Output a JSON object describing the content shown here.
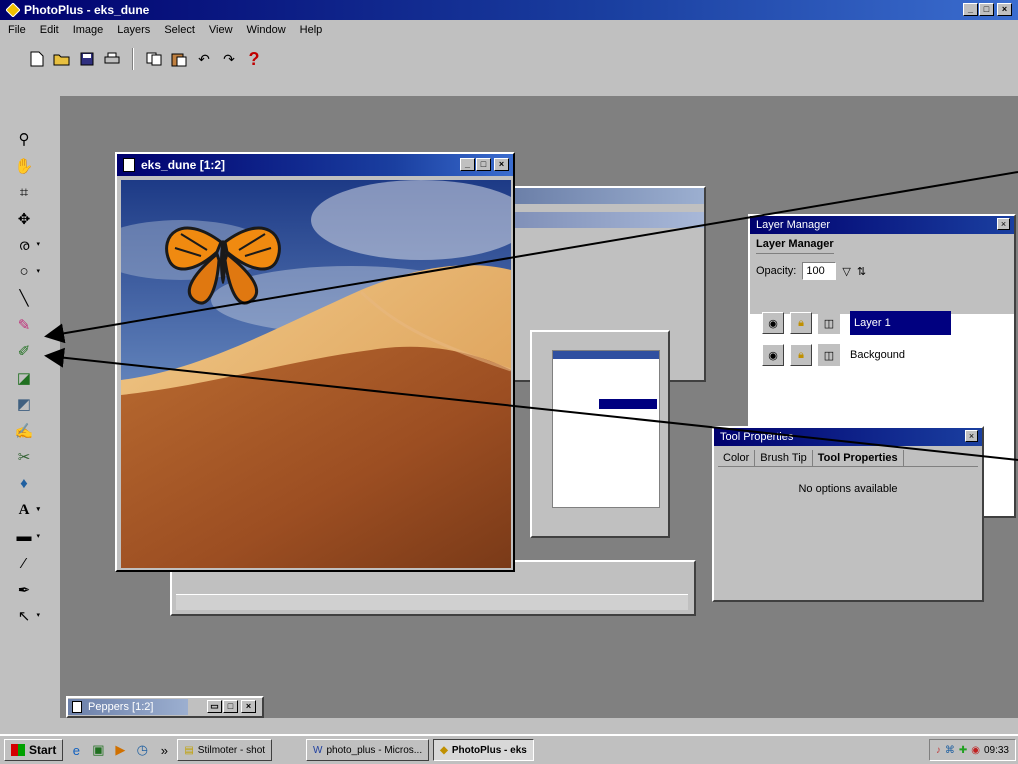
{
  "app": {
    "title": "PhotoPlus - eks_dune"
  },
  "menu": [
    "File",
    "Edit",
    "Image",
    "Layers",
    "Select",
    "View",
    "Window",
    "Help"
  ],
  "document": {
    "title": "eks_dune [1:2]"
  },
  "layer_manager": {
    "title": "Layer Manager",
    "tab": "Layer Manager",
    "opacity_label": "Opacity:",
    "opacity_value": "100",
    "layers": [
      {
        "name": "Layer 1",
        "selected": true
      },
      {
        "name": "Backgound",
        "selected": false
      }
    ]
  },
  "tool_properties": {
    "title": "Tool Properties",
    "tabs": [
      "Color",
      "Brush Tip",
      "Tool Properties"
    ],
    "active_tab": "Tool Properties",
    "message": "No options available"
  },
  "minimized_window": {
    "title": "Peppers [1:2]"
  },
  "taskbar": {
    "start": "Start",
    "tasks": [
      {
        "label": "Stilmoter - shot",
        "active": false
      },
      {
        "label": "photo_plus - Micros...",
        "active": false
      },
      {
        "label": "PhotoPlus - eks",
        "active": true
      }
    ],
    "clock": "09:33"
  },
  "colors": {
    "title_active": "#00006e",
    "title_inactive": "#6b7fa8",
    "selection": "#000080",
    "workspace": "#808080"
  }
}
